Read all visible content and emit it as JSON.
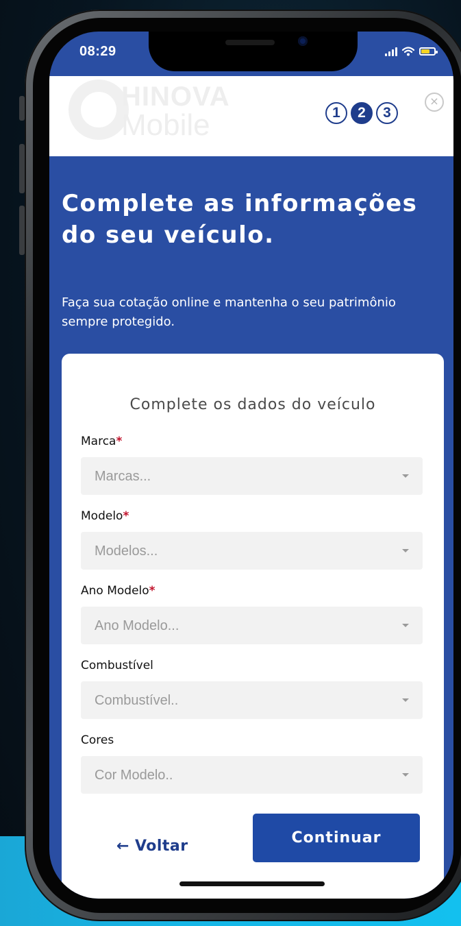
{
  "status_bar": {
    "time": "08:29",
    "icons": [
      "signal-icon",
      "wifi-icon",
      "battery-icon"
    ],
    "battery_color": "#f5d323"
  },
  "header": {
    "logo_line1": "HINOVA",
    "logo_line2": "Mobile",
    "steps": [
      "1",
      "2",
      "3"
    ],
    "active_step": "2",
    "close_label": "×"
  },
  "hero": {
    "title": "Complete as informações do seu veículo.",
    "subtitle": "Faça sua cotação online e mantenha o seu patrimônio sempre protegido."
  },
  "form": {
    "title": "Complete os dados do veículo",
    "required_mark": "*",
    "fields": [
      {
        "label": "Marca",
        "required": true,
        "placeholder": "Marcas..."
      },
      {
        "label": "Modelo",
        "required": true,
        "placeholder": "Modelos..."
      },
      {
        "label": "Ano Modelo",
        "required": true,
        "placeholder": "Ano Modelo..."
      },
      {
        "label": "Combustível",
        "required": false,
        "placeholder": "Combustível.."
      },
      {
        "label": "Cores",
        "required": false,
        "placeholder": "Cor Modelo.."
      }
    ],
    "back_arrow": "←",
    "back_label": "Voltar",
    "continue_label": "Continuar"
  },
  "colors": {
    "primary": "#1f3d8c",
    "background_blue": "#2a4ea3",
    "required": "#c0122b",
    "accent_cyan": "#17b6e6"
  }
}
